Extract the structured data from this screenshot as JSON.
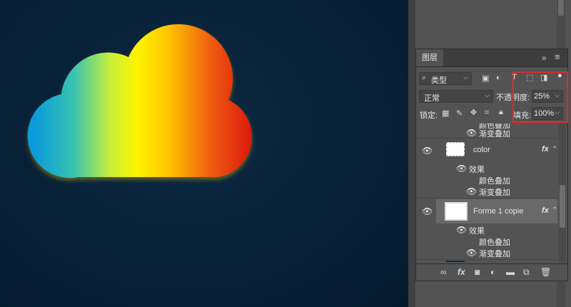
{
  "panel": {
    "tab_label": "图层",
    "collapse_label": "»",
    "menu_label": "≡"
  },
  "filter": {
    "icon": "search-icon",
    "label": "类型"
  },
  "blend": {
    "mode": "正常"
  },
  "opacity": {
    "label": "不透明度:",
    "value": "25%"
  },
  "fill": {
    "label": "填充:",
    "value": "100%"
  },
  "lock": {
    "label": "锁定:"
  },
  "layers": [
    {
      "id": "partial",
      "effects": [
        {
          "label": "颜色叠加"
        },
        {
          "label": "渐变叠加"
        }
      ]
    },
    {
      "id": "color",
      "name": "color",
      "fx": "fx",
      "effects_label": "效果",
      "effects": [
        {
          "label": "颜色叠加"
        },
        {
          "label": "渐变叠加"
        }
      ]
    },
    {
      "id": "forme",
      "name": "Forme 1 copie",
      "fx": "fx",
      "effects_label": "效果",
      "effects": [
        {
          "label": "颜色叠加"
        },
        {
          "label": "渐变叠加"
        }
      ]
    }
  ],
  "colors": {
    "canvas_bg": "#082036",
    "panel_bg": "#535353",
    "selected_row": "#696969",
    "highlight": "#e02a2a",
    "cloud_gradient": [
      "#0a9bdc",
      "#3cc4b0",
      "#c8f03a",
      "#fff200",
      "#ffb000",
      "#f06010",
      "#d80c0c"
    ]
  }
}
